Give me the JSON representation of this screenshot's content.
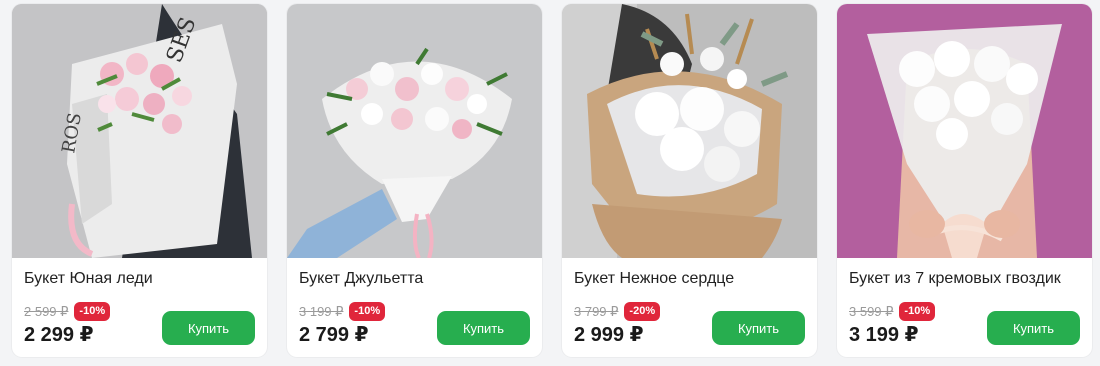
{
  "accent_color": "#27ae4f",
  "discount_color": "#e0263b",
  "products": [
    {
      "title": "Букет Юная леди",
      "old_price": "2 599 ₽",
      "discount": "-10%",
      "price": "2 299 ₽",
      "buy_label": "Купить",
      "image_icon": "bouquet-alstroemeria-newspaper"
    },
    {
      "title": "Букет Джульетта",
      "old_price": "3 199 ₽",
      "discount": "-10%",
      "price": "2 799 ₽",
      "buy_label": "Купить",
      "image_icon": "bouquet-alstroemeria-white"
    },
    {
      "title": "Букет Нежное сердце",
      "old_price": "3 799 ₽",
      "discount": "-20%",
      "price": "2 999 ₽",
      "buy_label": "Купить",
      "image_icon": "bouquet-chrysanthemum-cotton"
    },
    {
      "title": "Букет из 7 кремовых гвоздик",
      "old_price": "3 599 ₽",
      "discount": "-10%",
      "price": "3 199 ₽",
      "buy_label": "Купить",
      "image_icon": "bouquet-cream-carnations"
    }
  ]
}
